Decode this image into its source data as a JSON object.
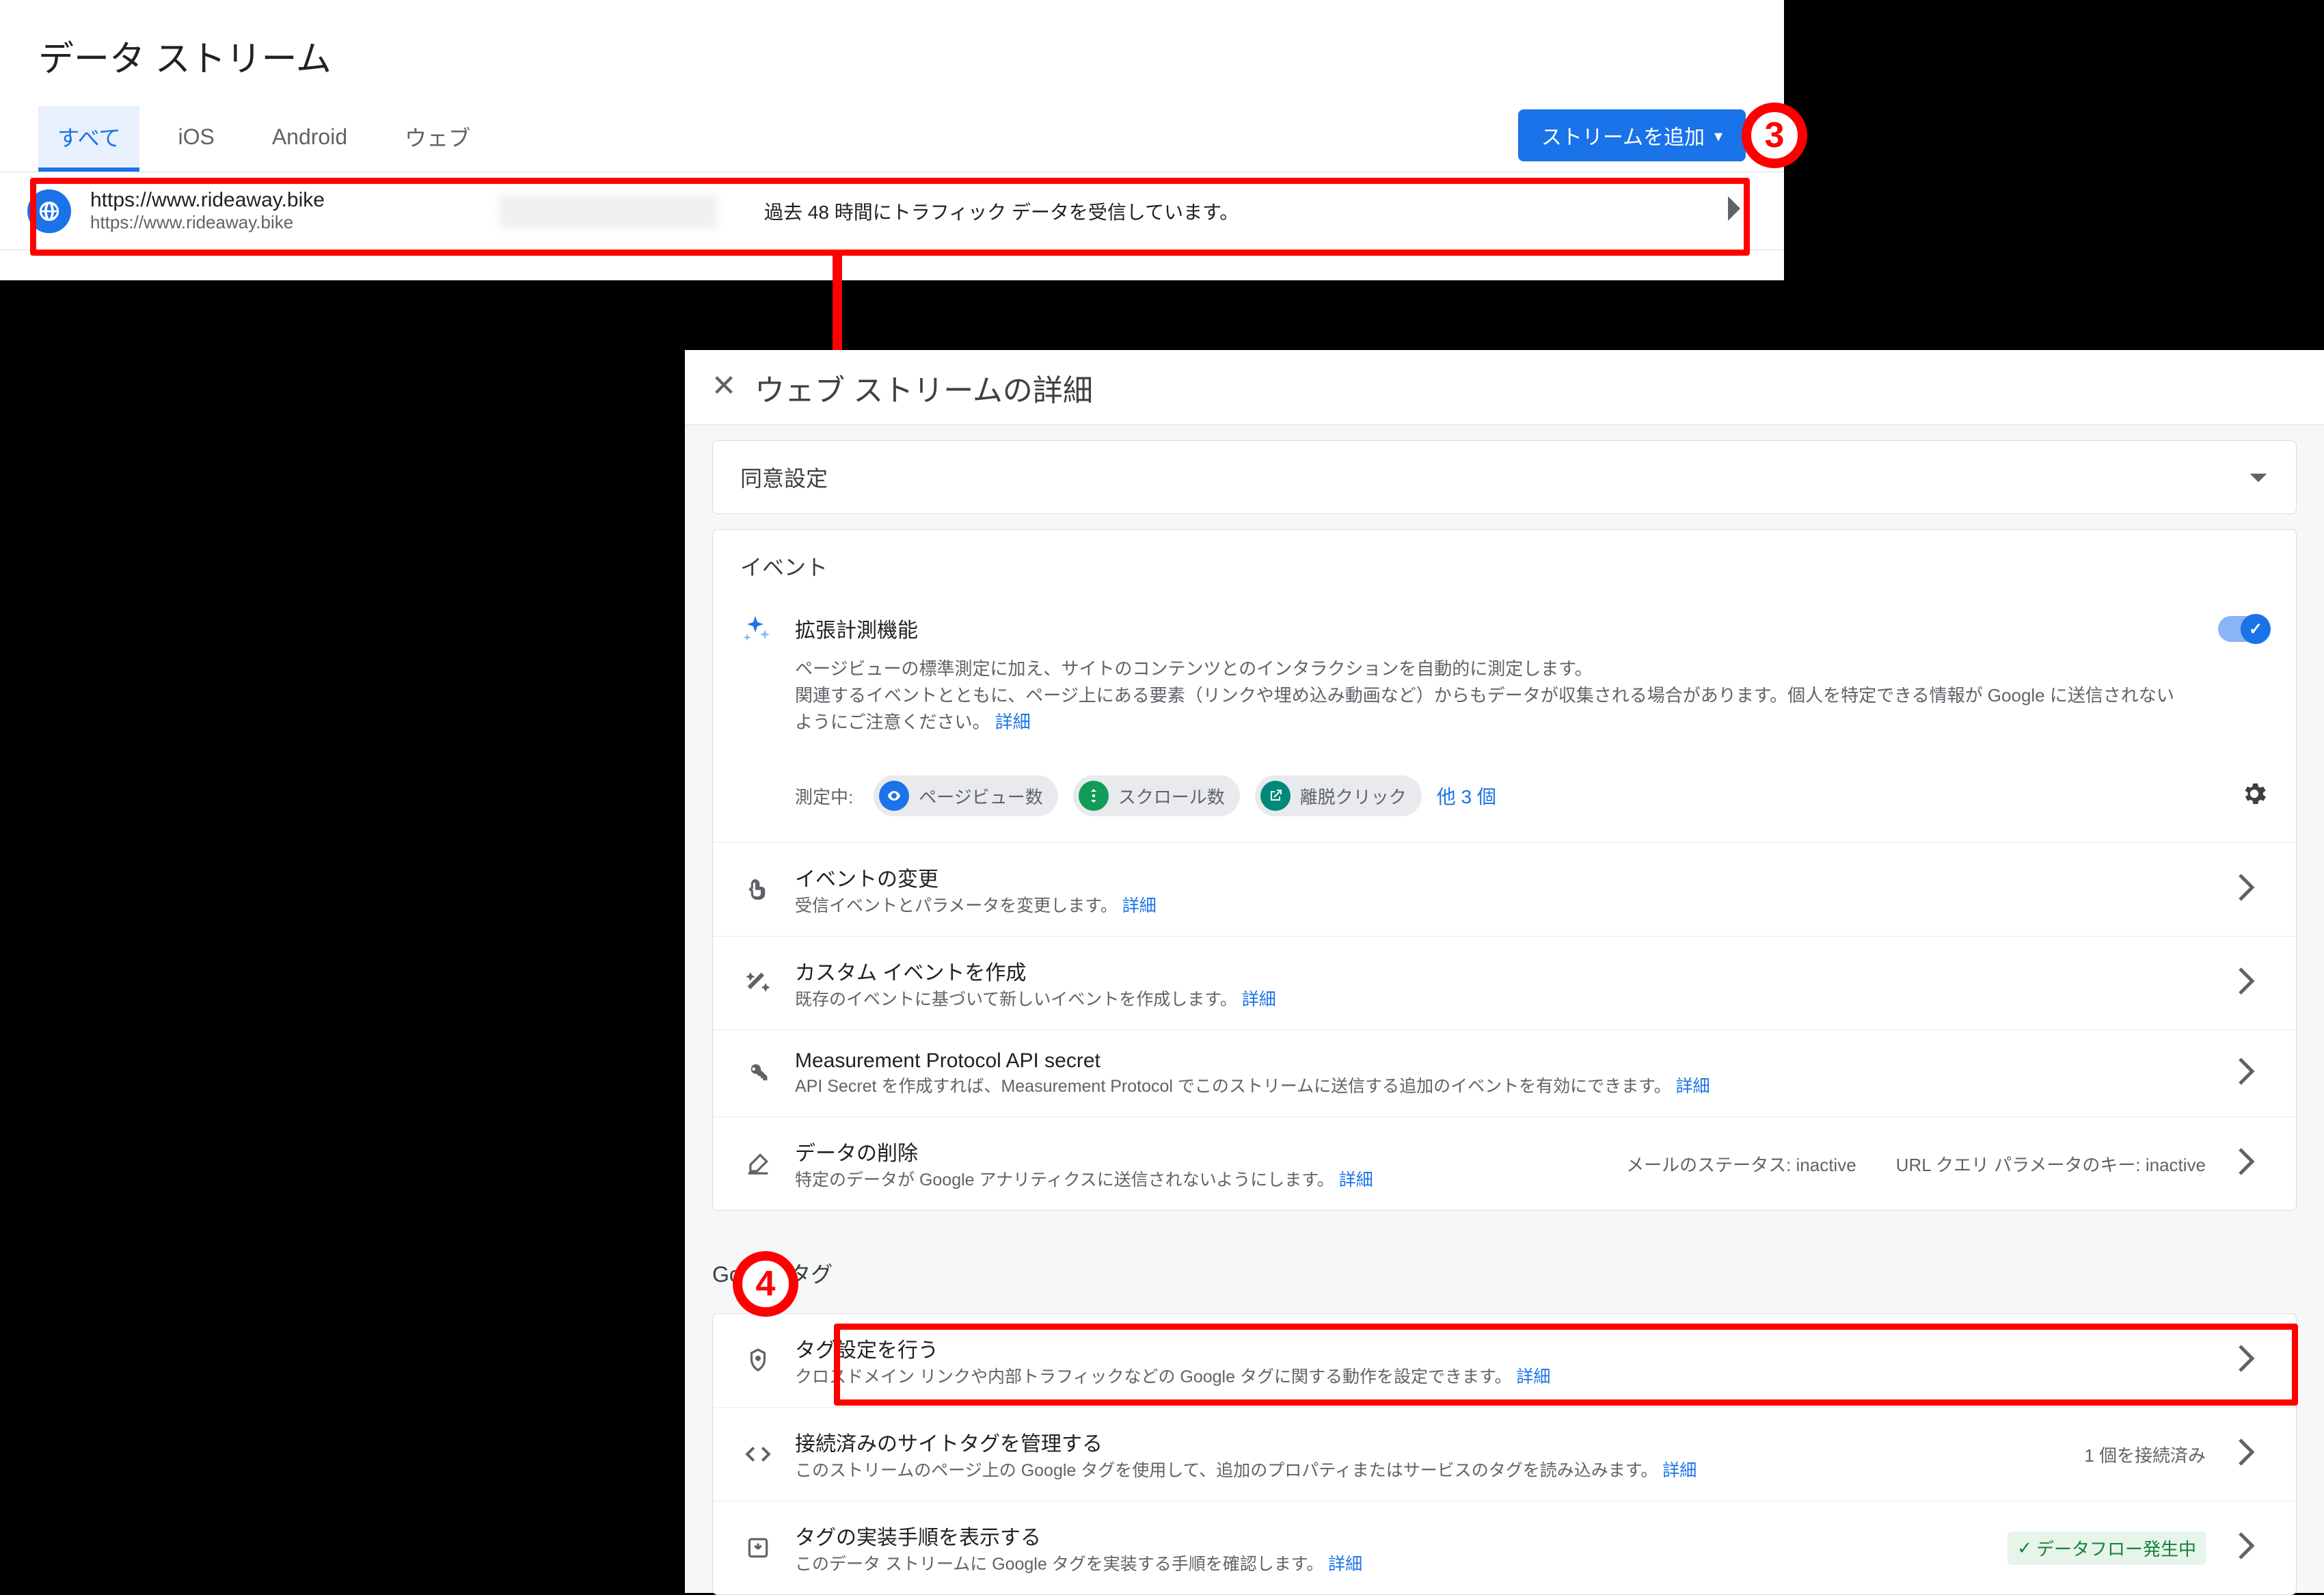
{
  "colors": {
    "accent": "#1a73e8",
    "annotation": "#ff0000"
  },
  "top": {
    "title": "データ ストリーム",
    "tabs": {
      "all": "すべて",
      "ios": "iOS",
      "android": "Android",
      "web": "ウェブ"
    },
    "add_stream_label": "ストリームを追加",
    "stream": {
      "name": "https://www.rideaway.bike",
      "url": "https://www.rideaway.bike",
      "status": "過去 48 時間にトラフィック データを受信しています。"
    }
  },
  "callouts": {
    "step3": "3",
    "step4": "4"
  },
  "detail": {
    "header_title": "ウェブ ストリームの詳細",
    "consent_label": "同意設定",
    "events_section": "イベント",
    "enhanced": {
      "title": "拡張計測機能",
      "desc1": "ページビューの標準測定に加え、サイトのコンテンツとのインタラクションを自動的に測定します。",
      "desc2": "関連するイベントとともに、ページ上にある要素（リンクや埋め込み動画など）からもデータが収集される場合があります。個人を特定できる情報が Google に送信されないようにご注意ください。",
      "learn_more": "詳細",
      "measuring_label": "測定中:",
      "chip_pageviews": "ページビュー数",
      "chip_scroll": "スクロール数",
      "chip_outclick": "離脱クリック",
      "more_chips": "他 3 個"
    },
    "rows": {
      "change_events": {
        "title": "イベントの変更",
        "desc": "受信イベントとパラメータを変更します。 ",
        "learn": "詳細"
      },
      "custom_events": {
        "title": "カスタム イベントを作成",
        "desc": "既存のイベントに基づいて新しいイベントを作成します。 ",
        "learn": "詳細"
      },
      "mp_api": {
        "title": "Measurement Protocol API secret",
        "desc": "API Secret を作成すれば、Measurement Protocol でこのストリームに送信する追加のイベントを有効にできます。 ",
        "learn": "詳細"
      },
      "redact": {
        "title": "データの削除",
        "desc": "特定のデータが Google アナリティクスに送信されないようにします。 ",
        "learn": "詳細",
        "badge1": "メールのステータス: inactive",
        "badge2": "URL クエリ パラメータのキー: inactive"
      }
    },
    "tag_section": "Google タグ",
    "tag_rows": {
      "tag_settings": {
        "title": "タグ設定を行う",
        "desc": "クロスドメイン リンクや内部トラフィックなどの Google タグに関する動作を設定できます。 ",
        "learn": "詳細"
      },
      "connected_tags": {
        "title": "接続済みのサイトタグを管理する",
        "desc": "このストリームのページ上の Google タグを使用して、追加のプロパティまたはサービスのタグを読み込みます。 ",
        "learn": "詳細",
        "badge": "1 個を接続済み"
      },
      "install": {
        "title": "タグの実装手順を表示する",
        "desc": "このデータ ストリームに Google タグを実装する手順を確認します。 ",
        "learn": "詳細",
        "badge": "データフロー発生中"
      }
    }
  }
}
